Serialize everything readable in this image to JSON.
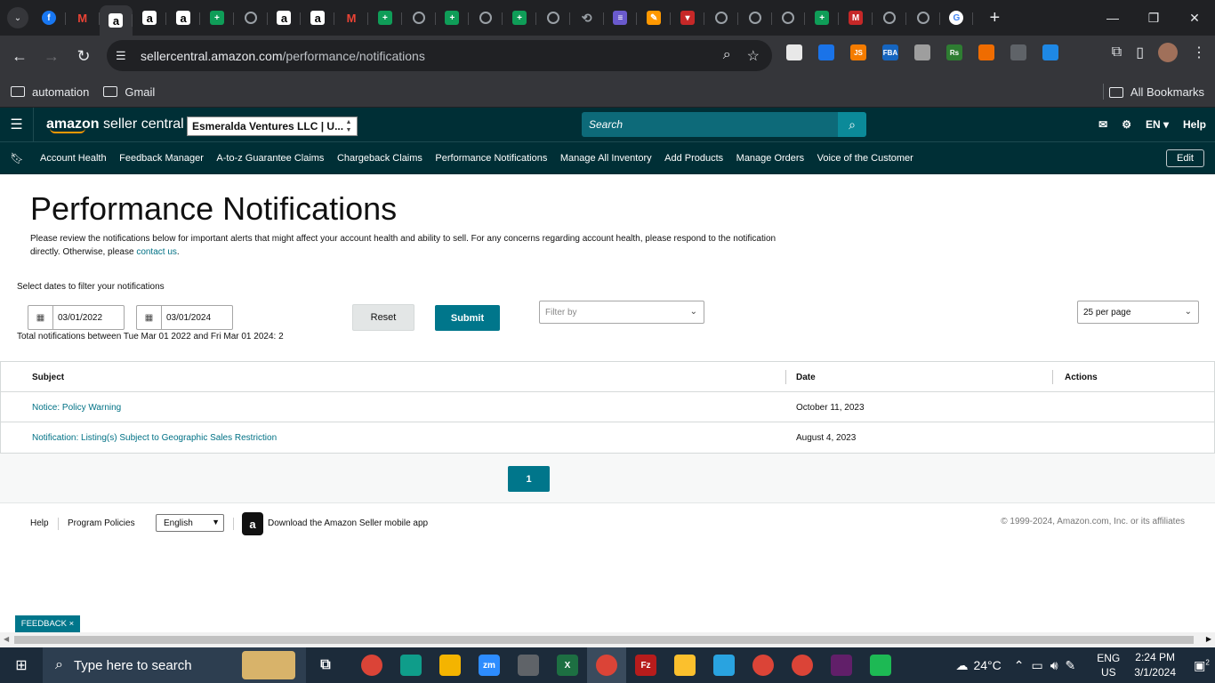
{
  "browser": {
    "tabs": [
      {
        "icon": "facebook-icon",
        "label": "f",
        "style": "fb"
      },
      {
        "icon": "gmail-icon",
        "label": "M",
        "style": "gm"
      },
      {
        "icon": "amazon-icon",
        "label": "a",
        "style": "az",
        "active": true
      },
      {
        "icon": "amazon-icon",
        "label": "a",
        "style": "az"
      },
      {
        "icon": "amazon-icon",
        "label": "a",
        "style": "az"
      },
      {
        "icon": "sheets-icon",
        "label": "+",
        "style": "sh"
      },
      {
        "icon": "globe-icon",
        "label": "",
        "style": "gl"
      },
      {
        "icon": "amazon-icon",
        "label": "a",
        "style": "az"
      },
      {
        "icon": "amazon-icon",
        "label": "a",
        "style": "az"
      },
      {
        "icon": "gmail-icon",
        "label": "M",
        "style": "gm"
      },
      {
        "icon": "sheets-icon",
        "label": "+",
        "style": "sh"
      },
      {
        "icon": "globe-icon",
        "label": "",
        "style": "gl"
      },
      {
        "icon": "sheets-icon",
        "label": "+",
        "style": "sh"
      },
      {
        "icon": "globe-icon",
        "label": "",
        "style": "gl"
      },
      {
        "icon": "sheets-icon",
        "label": "+",
        "style": "sh"
      },
      {
        "icon": "globe-icon",
        "label": "",
        "style": "gl"
      },
      {
        "icon": "history-icon",
        "label": "⟲",
        "style": "hi"
      },
      {
        "icon": "list-icon",
        "label": "≡",
        "style": "pu"
      },
      {
        "icon": "pencil-icon",
        "label": "✎",
        "style": "ds"
      },
      {
        "icon": "red-app-icon",
        "label": "▾",
        "style": "rd"
      },
      {
        "icon": "globe-icon",
        "label": "",
        "style": "gl"
      },
      {
        "icon": "globe-icon",
        "label": "",
        "style": "gl"
      },
      {
        "icon": "chrome-icon",
        "label": "",
        "style": "gl"
      },
      {
        "icon": "sheets-icon",
        "label": "+",
        "style": "sh"
      },
      {
        "icon": "m-app-icon",
        "label": "M",
        "style": "rd"
      },
      {
        "icon": "globe-icon",
        "label": "",
        "style": "gl"
      },
      {
        "icon": "globe-icon",
        "label": "",
        "style": "gl"
      },
      {
        "icon": "google-icon",
        "label": "G",
        "style": "go"
      }
    ],
    "url_host": "sellercentral.amazon.com",
    "url_path": "/performance/notifications",
    "bookmarks": [
      "automation",
      "Gmail"
    ],
    "all_bookmarks": "All Bookmarks",
    "extensions": [
      {
        "name": "ext-icon",
        "color": "#e8e8e8"
      },
      {
        "name": "ext-icon",
        "color": "#1a73e8"
      },
      {
        "name": "js-icon",
        "color": "#f57c00",
        "label": "JS"
      },
      {
        "name": "fba-icon",
        "color": "#1565c0",
        "label": "FBA"
      },
      {
        "name": "ext-icon",
        "color": "#9e9e9e"
      },
      {
        "name": "ext-icon",
        "color": "#2e7d32",
        "label": "Rs"
      },
      {
        "name": "ext-icon",
        "color": "#ef6c00"
      },
      {
        "name": "globe-icon",
        "color": "#5f6368"
      },
      {
        "name": "ext-icon",
        "color": "#1e88e5"
      }
    ]
  },
  "header": {
    "logo_bold": "amazon",
    "logo_rest": " seller central",
    "account": "Esmeralda Ventures LLC | U...",
    "search_placeholder": "Search",
    "lang": "EN ▾",
    "help": "Help"
  },
  "nav": {
    "links": [
      "Account Health",
      "Feedback Manager",
      "A-to-z Guarantee Claims",
      "Chargeback Claims",
      "Performance Notifications",
      "Manage All Inventory",
      "Add Products",
      "Manage Orders",
      "Voice of the Customer"
    ],
    "edit": "Edit"
  },
  "page": {
    "title": "Performance Notifications",
    "intro_text": "Please review the notifications below for important alerts that might affect your account health and ability to sell. For any concerns regarding account health, please respond to the notification directly. Otherwise, please ",
    "intro_link": "contact us",
    "intro_end": ".",
    "filter_label": "Select dates to filter your notifications",
    "date_from": "03/01/2022",
    "date_to": "03/01/2024",
    "total": "Total notifications between Tue Mar 01 2022 and Fri Mar 01 2024: 2",
    "reset": "Reset",
    "submit": "Submit",
    "filter_by": "Filter by",
    "per_page": "25 per page"
  },
  "table": {
    "headers": {
      "subject": "Subject",
      "date": "Date",
      "actions": "Actions"
    },
    "rows": [
      {
        "subject": "Notice: Policy Warning",
        "date": "October 11, 2023"
      },
      {
        "subject": "Notification: Listing(s) Subject to Geographic Sales Restriction",
        "date": "August 4, 2023"
      }
    ]
  },
  "pagination": {
    "current": "1"
  },
  "footer": {
    "help": "Help",
    "policies": "Program Policies",
    "language": "English",
    "app_text": "Download the Amazon Seller mobile app",
    "copyright": "© 1999-2024, Amazon.com, Inc. or its affiliates"
  },
  "feedback": "FEEDBACK ×",
  "taskbar": {
    "search": "Type here to search",
    "apps": [
      {
        "name": "chrome-icon",
        "color": "#db4437"
      },
      {
        "name": "edge-icon",
        "color": "#0f9d8a"
      },
      {
        "name": "explorer-icon",
        "color": "#f4b400"
      },
      {
        "name": "zoom-icon",
        "color": "#2d8cff",
        "label": "zm"
      },
      {
        "name": "calculator-icon",
        "color": "#5f6368"
      },
      {
        "name": "excel-icon",
        "color": "#1d6f42",
        "label": "X"
      },
      {
        "name": "chrome-icon",
        "color": "#db4437",
        "active": true
      },
      {
        "name": "filezilla-icon",
        "color": "#b71c1c",
        "label": "Fz"
      },
      {
        "name": "sticky-notes-icon",
        "color": "#fbc02d"
      },
      {
        "name": "telegram-icon",
        "color": "#29a3e0"
      },
      {
        "name": "chrome-icon",
        "color": "#db4437"
      },
      {
        "name": "chrome-icon",
        "color": "#db4437"
      },
      {
        "name": "slack-icon",
        "color": "#611f69"
      },
      {
        "name": "spotify-icon",
        "color": "#1db954"
      }
    ],
    "temperature": "24°C",
    "lang_top": "ENG",
    "lang_bottom": "US",
    "time": "2:24 PM",
    "date": "3/1/2024",
    "notif_count": "2"
  }
}
